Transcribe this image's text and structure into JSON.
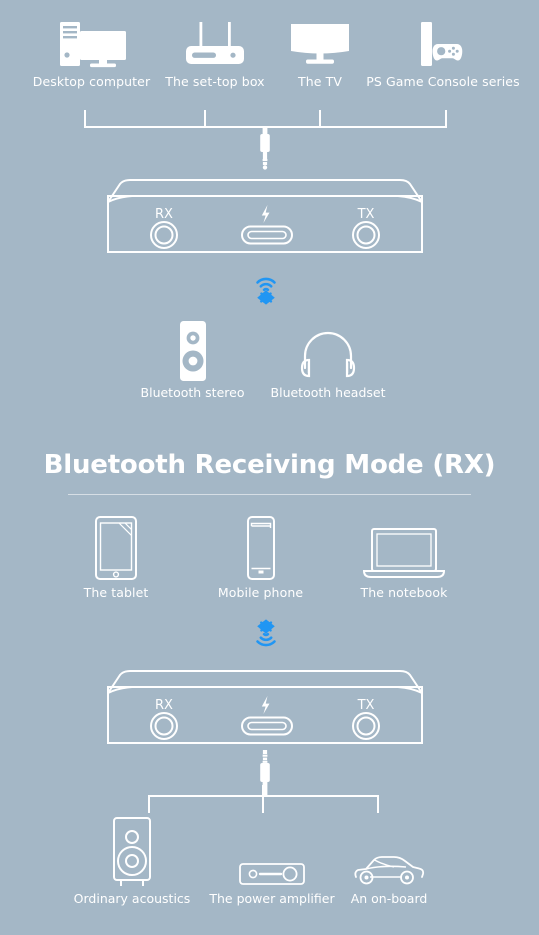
{
  "theme": {
    "background": "#a4b7c6",
    "line": "#ffffff",
    "text": "#ffffff",
    "accent_bluetooth": "#2196f3",
    "rule": "rgba(255,255,255,0.55)"
  },
  "transmitting_section": {
    "sources": [
      {
        "label": "Desktop computer",
        "icon": "desktop-computer-icon"
      },
      {
        "label": "The set-top box",
        "icon": "set-top-box-icon"
      },
      {
        "label": "The TV",
        "icon": "tv-icon"
      },
      {
        "label": "PS Game Console series",
        "icon": "game-console-icon"
      }
    ],
    "connector": {
      "name": "source-bracket",
      "tick_count": 4
    },
    "cable": {
      "name": "audio-jack-plug",
      "icon": "audio-plug-icon"
    },
    "device": {
      "name": "bluetooth-adapter-tx",
      "ports": [
        {
          "label": "RX",
          "icon": "audio-jack-port-icon"
        },
        {
          "label": "⚡",
          "icon": "usb-c-power-port-icon"
        },
        {
          "label": "TX",
          "icon": "audio-jack-port-icon"
        }
      ]
    },
    "wireless": {
      "name": "bluetooth-transmit-icon",
      "direction": "up"
    },
    "outputs": [
      {
        "label": "Bluetooth stereo",
        "icon": "bluetooth-speaker-icon"
      },
      {
        "label": "Bluetooth headset",
        "icon": "headphones-icon"
      }
    ]
  },
  "receiving_section": {
    "title": "Bluetooth Receiving Mode (RX)",
    "sources": [
      {
        "label": "The tablet",
        "icon": "tablet-icon"
      },
      {
        "label": "Mobile phone",
        "icon": "mobile-phone-icon"
      },
      {
        "label": "The notebook",
        "icon": "laptop-icon"
      }
    ],
    "wireless": {
      "name": "bluetooth-receive-icon",
      "direction": "down"
    },
    "device": {
      "name": "bluetooth-adapter-rx",
      "ports": [
        {
          "label": "RX",
          "icon": "audio-jack-port-icon"
        },
        {
          "label": "⚡",
          "icon": "usb-c-power-port-icon"
        },
        {
          "label": "TX",
          "icon": "audio-jack-port-icon"
        }
      ]
    },
    "cable": {
      "name": "audio-jack-plug",
      "icon": "audio-plug-icon"
    },
    "connector": {
      "name": "output-bracket",
      "tick_count": 3
    },
    "outputs": [
      {
        "label": "Ordinary acoustics",
        "icon": "studio-speaker-icon"
      },
      {
        "label": "The power amplifier",
        "icon": "amplifier-icon"
      },
      {
        "label": "An on-board",
        "icon": "car-icon"
      }
    ]
  }
}
